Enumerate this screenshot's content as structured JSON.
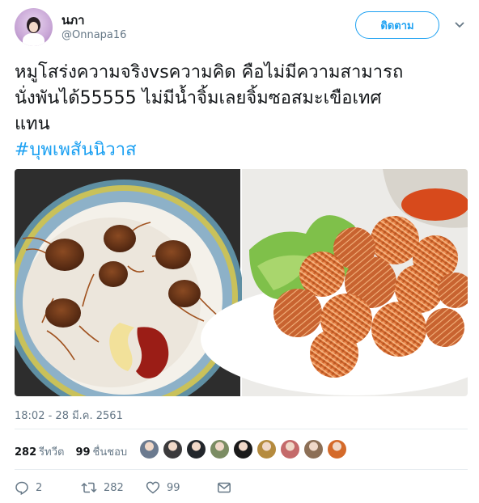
{
  "author": {
    "name": "นภา",
    "handle": "@Onnapa16"
  },
  "follow_label": "ติดตาม",
  "tweet": {
    "lines": [
      "หมูโสร่งความจริงvsความคิด คือไม่มีความสามารถ",
      "นั่งพันได้55555  ไม่มีน้ำจิ้มเลยจิ้มซอสมะเขือเทศ",
      "แทน"
    ],
    "hashtag": "#บุพเพสันนิวาส"
  },
  "timestamp": "18:02 - 28 มี.ค. 2561",
  "stats": {
    "retweets_count": "282",
    "retweets_label": "รีทวีต",
    "likes_count": "99",
    "likes_label": "ชื่นชอบ"
  },
  "likers": [
    {
      "color": "#6b7a8f"
    },
    {
      "color": "#3b3a3c"
    },
    {
      "color": "#22262b"
    },
    {
      "color": "#7b8c63"
    },
    {
      "color": "#1a1a1a"
    },
    {
      "color": "#b58b3e"
    },
    {
      "color": "#c46a6a"
    },
    {
      "color": "#8c6f56"
    },
    {
      "color": "#d46a2a"
    }
  ],
  "actions": {
    "replies": "2",
    "retweets": "282",
    "likes": "99"
  },
  "colors": {
    "accent": "#1da1f2",
    "muted": "#657786"
  },
  "icons": [
    "chevron-down-icon",
    "reply-icon",
    "retweet-icon",
    "like-icon",
    "message-icon"
  ]
}
